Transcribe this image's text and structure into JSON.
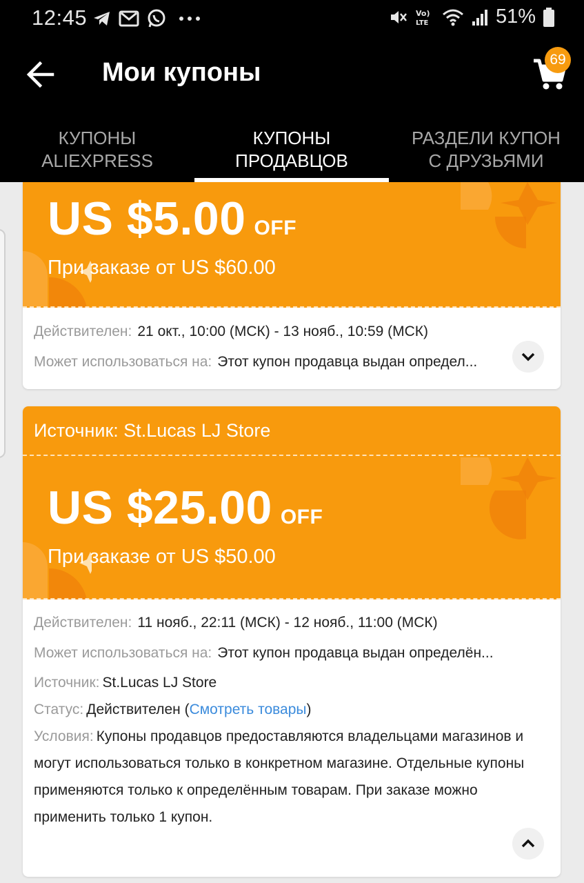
{
  "status_bar": {
    "time": "12:45",
    "battery": "51%",
    "left_icons": [
      "telegram-icon",
      "gmail-icon",
      "whatsapp-icon",
      "more-dots-icon"
    ],
    "right_icons": [
      "mute-icon",
      "volte-icon",
      "wifi-icon",
      "signal-icon",
      "battery-icon"
    ]
  },
  "toolbar": {
    "title": "Мои купоны",
    "cart_count": "69"
  },
  "tabs": [
    {
      "line1": "КУПОНЫ",
      "line2": "ALIEXPRESS",
      "active": false
    },
    {
      "line1": "КУПОНЫ",
      "line2": "ПРОДАВЦОВ",
      "active": true
    },
    {
      "line1": "РАЗДЕЛИ КУПОН",
      "line2": "С ДРУЗЬЯМИ",
      "active": false
    }
  ],
  "colors": {
    "coupon_orange": "#f89a0d",
    "badge": "#f79b0f",
    "link": "#3b8bdc"
  },
  "coupons": [
    {
      "amount": "US $5.00",
      "off": "OFF",
      "min_order": "При заказе от US $60.00",
      "valid_label": "Действителен:",
      "valid_value": "21 окт., 10:00 (МСК) - 13 нояб., 10:59 (МСК)",
      "usable_label": "Может использоваться на:",
      "usable_value": "Этот купон продавца выдан определ...",
      "expand_icon": "chevron-down-icon"
    },
    {
      "source_header": "Источник: St.Lucas LJ Store",
      "amount": "US $25.00",
      "off": "OFF",
      "min_order": "При заказе от US $50.00",
      "valid_label": "Действителен:",
      "valid_value": "11 нояб., 22:11 (МСК) - 12 нояб., 11:00 (МСК)",
      "usable_label": "Может использоваться на:",
      "usable_value": "Этот купон продавца выдан определён...",
      "source_label": "Источник:",
      "source_value": "St.Lucas LJ Store",
      "status_label": "Статус:",
      "status_value": "Действителен (",
      "status_link": "Смотреть товары",
      "status_close": ")",
      "conditions_label": "Условия:",
      "conditions_value": "Купоны продавцов предоставляются владельцами магазинов и могут использоваться только в конкретном магазине. Отдельные купоны применяются только к определённым товарам. При заказе можно применить только 1 купон.",
      "collapse_icon": "chevron-up-icon"
    }
  ]
}
